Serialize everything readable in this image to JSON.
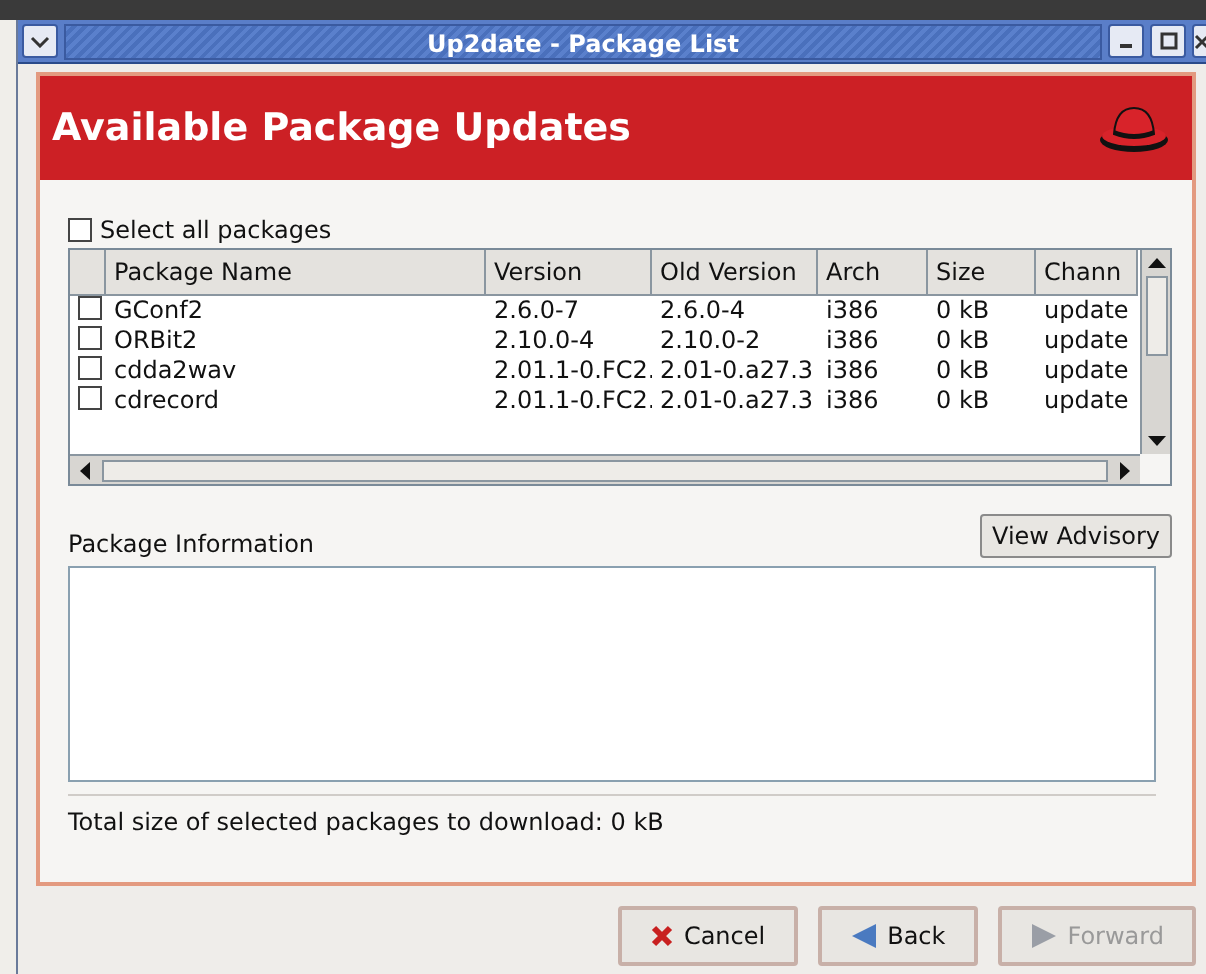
{
  "window": {
    "title": "Up2date - Package List"
  },
  "banner": {
    "title": "Available Package Updates"
  },
  "select_all": {
    "label": "Select all packages",
    "checked": false
  },
  "table": {
    "columns": [
      "Package Name",
      "Version",
      "Old Version",
      "Arch",
      "Size",
      "Chann"
    ],
    "rows": [
      {
        "checked": false,
        "cells": [
          "GConf2",
          "2.6.0-7",
          "2.6.0-4",
          "i386",
          "0 kB",
          "update"
        ]
      },
      {
        "checked": false,
        "cells": [
          "ORBit2",
          "2.10.0-4",
          "2.10.0-2",
          "i386",
          "0 kB",
          "update"
        ]
      },
      {
        "checked": false,
        "cells": [
          "cdda2wav",
          "2.01.1-0.FC2.",
          "2.01-0.a27.3",
          "i386",
          "0 kB",
          "update"
        ]
      },
      {
        "checked": false,
        "cells": [
          "cdrecord",
          "2.01.1-0.FC2.",
          "2.01-0.a27.3",
          "i386",
          "0 kB",
          "update"
        ]
      }
    ]
  },
  "info": {
    "label": "Package Information",
    "button": "View Advisory"
  },
  "total": "Total size of selected packages to download: 0 kB",
  "buttons": [
    {
      "kind": "cancel",
      "label": "Cancel",
      "disabled": false
    },
    {
      "kind": "back",
      "label": "Back",
      "disabled": false
    },
    {
      "kind": "forward",
      "label": "Forward",
      "disabled": true
    }
  ]
}
